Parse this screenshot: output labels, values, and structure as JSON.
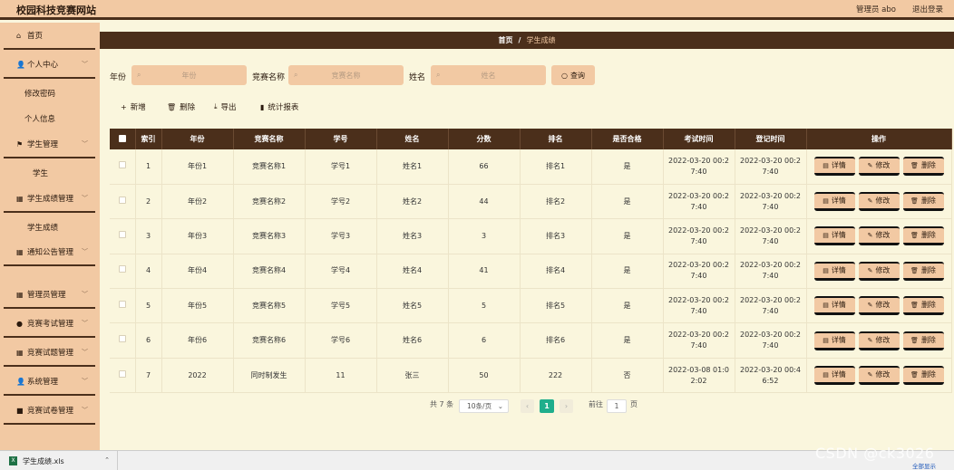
{
  "header": {
    "title": "校园科技竞赛网站",
    "user": "管理员 abo",
    "logout": "退出登录"
  },
  "sidebar": {
    "items": [
      {
        "label": "首页",
        "icon": "home-icon",
        "glyph": "⌂"
      },
      {
        "label": "个人中心",
        "icon": "user-icon",
        "glyph": "👤"
      },
      {
        "label": "学生管理",
        "icon": "flag-icon",
        "glyph": "⚑"
      },
      {
        "label": "学生成绩管理",
        "icon": "grid-icon",
        "glyph": "▦"
      },
      {
        "label": "通知公告管理",
        "icon": "grid-icon",
        "glyph": "▦"
      },
      {
        "label": "管理员管理",
        "icon": "grid-icon",
        "glyph": "▦"
      },
      {
        "label": "竞赛考试管理",
        "icon": "pin-icon",
        "glyph": "●"
      },
      {
        "label": "竞赛试题管理",
        "icon": "grid-icon",
        "glyph": "▦"
      },
      {
        "label": "系统管理",
        "icon": "user-icon",
        "glyph": "👤"
      },
      {
        "label": "竞赛试卷管理",
        "icon": "lock-icon",
        "glyph": "■"
      }
    ],
    "subitems": {
      "change_password": "修改密码",
      "profile": "个人信息",
      "student": "学生",
      "student_score": "学生成绩"
    }
  },
  "breadcrumb": {
    "home": "首页",
    "sep": "/",
    "current": "学生成绩"
  },
  "filters": {
    "year_label": "年份",
    "year_placeholder": "年份",
    "comp_label": "竞赛名称",
    "comp_placeholder": "竞赛名称",
    "name_label": "姓名",
    "name_placeholder": "姓名",
    "query": "查询"
  },
  "actions": {
    "add": "新增",
    "delete": "删除",
    "export": "导出",
    "stats": "统计报表"
  },
  "table": {
    "headers": [
      "索引",
      "年份",
      "竞赛名称",
      "学号",
      "姓名",
      "分数",
      "排名",
      "是否合格",
      "考试时间",
      "登记时间",
      "操作"
    ],
    "rows": [
      {
        "idx": "1",
        "year": "年份1",
        "comp": "竞赛名称1",
        "sid": "学号1",
        "name": "姓名1",
        "score": "66",
        "rank": "排名1",
        "pass": "是",
        "exam_time": "2022-03-20 00:2 7:40",
        "reg_time": "2022-03-20 00:2 7:40"
      },
      {
        "idx": "2",
        "year": "年份2",
        "comp": "竞赛名称2",
        "sid": "学号2",
        "name": "姓名2",
        "score": "44",
        "rank": "排名2",
        "pass": "是",
        "exam_time": "2022-03-20 00:2 7:40",
        "reg_time": "2022-03-20 00:2 7:40"
      },
      {
        "idx": "3",
        "year": "年份3",
        "comp": "竞赛名称3",
        "sid": "学号3",
        "name": "姓名3",
        "score": "3",
        "rank": "排名3",
        "pass": "是",
        "exam_time": "2022-03-20 00:2 7:40",
        "reg_time": "2022-03-20 00:2 7:40"
      },
      {
        "idx": "4",
        "year": "年份4",
        "comp": "竞赛名称4",
        "sid": "学号4",
        "name": "姓名4",
        "score": "41",
        "rank": "排名4",
        "pass": "是",
        "exam_time": "2022-03-20 00:2 7:40",
        "reg_time": "2022-03-20 00:2 7:40"
      },
      {
        "idx": "5",
        "year": "年份5",
        "comp": "竞赛名称5",
        "sid": "学号5",
        "name": "姓名5",
        "score": "5",
        "rank": "排名5",
        "pass": "是",
        "exam_time": "2022-03-20 00:2 7:40",
        "reg_time": "2022-03-20 00:2 7:40"
      },
      {
        "idx": "6",
        "year": "年份6",
        "comp": "竞赛名称6",
        "sid": "学号6",
        "name": "姓名6",
        "score": "6",
        "rank": "排名6",
        "pass": "是",
        "exam_time": "2022-03-20 00:2 7:40",
        "reg_time": "2022-03-20 00:2 7:40"
      },
      {
        "idx": "7",
        "year": "2022",
        "comp": "同时制发生",
        "sid": "11",
        "name": "张三",
        "score": "50",
        "rank": "222",
        "pass": "否",
        "exam_time": "2022-03-08 01:0 2:02",
        "reg_time": "2022-03-20 00:4 6:52"
      }
    ],
    "ops": {
      "detail": "详情",
      "edit": "修改",
      "delete": "删除"
    }
  },
  "pagination": {
    "total": "共 7 条",
    "page_size": "10条/页",
    "current": "1",
    "goto": "前往",
    "goto_value": "1",
    "page_unit": "页"
  },
  "download": {
    "file": "学生成绩.xls",
    "show_all": "全部显示"
  },
  "watermark": "CSDN @ck3026",
  "colors": {
    "peach": "#f2c9a3",
    "dark_brown": "#4b2f1b",
    "cream": "#faf6dd",
    "teal": "#1fae8c"
  }
}
